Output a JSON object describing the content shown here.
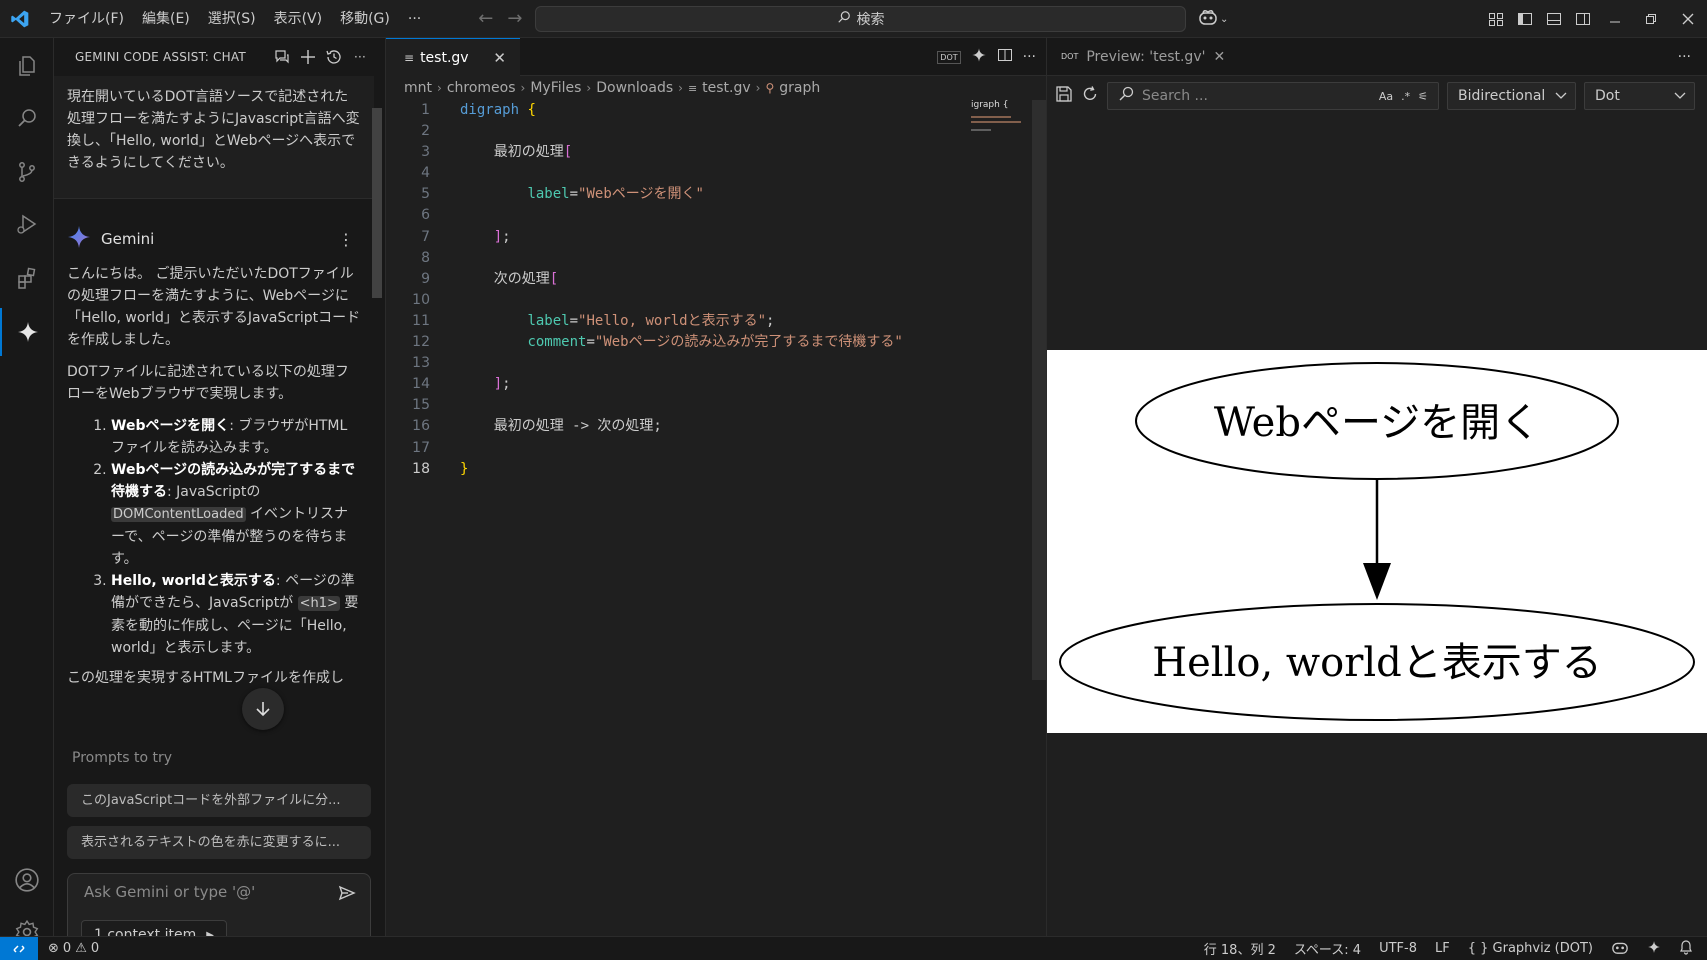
{
  "titlebar": {
    "menus": [
      "ファイル(F)",
      "編集(E)",
      "選択(S)",
      "表示(V)",
      "移動(G)",
      "···"
    ],
    "search": "検索"
  },
  "gemini": {
    "header": "GEMINI CODE ASSIST: CHAT",
    "user_message": "現在開いているDOT言語ソースで記述された処理フローを満たすようにJavascript言語へ変換し、「Hello, world」とWebページへ表示できるようにしてください。",
    "assistant_name": "Gemini",
    "para1": "こんにちは。 ご提示いただいたDOTファイルの処理フローを満たすように、Webページに「Hello, world」と表示するJavaScriptコードを作成しました。",
    "para2": "DOTファイルに記述されている以下の処理フローをWebブラウザで実現します。",
    "steps": [
      {
        "title": "Webページを開く",
        "text": ": ブラウザがHTMLファイルを読み込みます。"
      },
      {
        "title": "Webページの読み込みが完了するまで待機する",
        "text_a": ": JavaScriptの ",
        "code": "DOMContentLoaded",
        "text_b": " イベントリスナーで、ページの準備が整うのを待ちます。"
      },
      {
        "title": "Hello, worldと表示する",
        "text_a": ": ページの準備ができたら、JavaScriptが ",
        "code": "<h1>",
        "text_b": " 要素を動的に作成し、ページに「Hello, world」と表示します。"
      }
    ],
    "para3": "この処理を実現するHTMLファイルを作成し",
    "prompts_title": "Prompts to try",
    "prompt1": "このJavaScriptコードを外部ファイルに分...",
    "prompt2": "表示されるテキストの色を赤に変更するに...",
    "input_placeholder": "Ask Gemini or type '@'",
    "context_item": "1 context item"
  },
  "editor": {
    "tab_label": "test.gv",
    "breadcrumb": [
      "mnt",
      "chromeos",
      "MyFiles",
      "Downloads",
      "test.gv",
      "graph"
    ],
    "minimap_text": "igraph {",
    "code": {
      "l1_kw": "digraph",
      "l1_br": "{",
      "l3": "最初の処理",
      "l5_attr": "label",
      "l5_str": "\"Webページを開く\"",
      "l9": "次の処理",
      "l11_attr": "label",
      "l11_str": "\"Hello, worldと表示する\"",
      "l12_attr": "comment",
      "l12_str": "\"Webページの読み込みが完了するまで待機する\"",
      "l16": "最初の処理 -> 次の処理;",
      "l18": "}"
    }
  },
  "preview": {
    "tab_label": "Preview: 'test.gv'",
    "search_placeholder": "Search ...",
    "search_opt1": "Aa",
    "direction": "Bidirectional",
    "engine": "Dot",
    "node1": "Webページを開く",
    "node2": "Hello, worldと表示する"
  },
  "status": {
    "errors": "0",
    "warnings": "0",
    "position": "行 18、列 2",
    "spaces": "スペース: 4",
    "encoding": "UTF-8",
    "eol": "LF",
    "language": "{ } Graphviz (DOT)"
  },
  "colors": {
    "accent": "#0078d4",
    "gemini_star": "#4285f4"
  }
}
